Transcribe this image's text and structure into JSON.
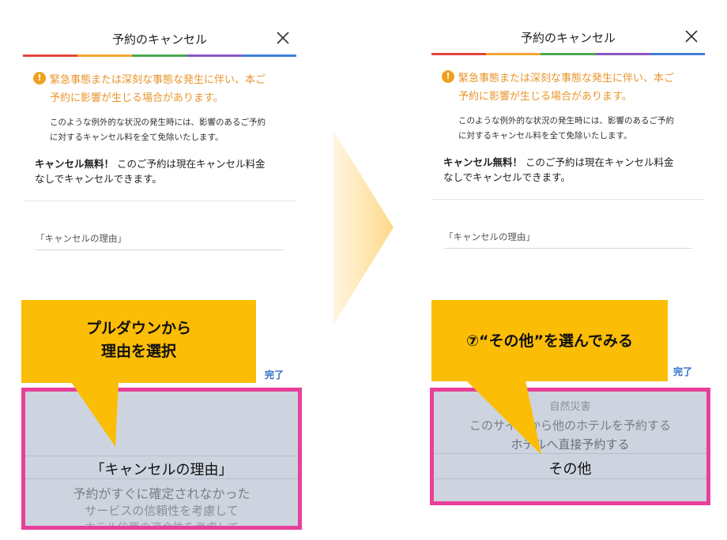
{
  "left": {
    "title": "予約のキャンセル",
    "alert_title_1": "緊急事態または深刻な事態な発生に伴い、本ご",
    "alert_title_2": "予約に影響が生じる場合があります。",
    "alert_body_1": "このような例外的な状況の発生時には、影響のあるご予約",
    "alert_body_2": "に対するキャンセル料を全て免除いたします。",
    "free_bold": "キャンセル無料！",
    "free_rest_1": " このご予約は現在キャンセル料金",
    "free_rest_2": "なしでキャンセルできます。",
    "reason_field": "「キャンセルの理由」",
    "done_label": "完了",
    "picker": {
      "selected": "「キャンセルの理由」",
      "option_1": "予約がすぐに確定されなかった",
      "option_2": "サービスの信頼性を考慮して",
      "option_3": "ホテル位置の適合性を考慮して"
    },
    "callout_line_1": "プルダウンから",
    "callout_line_2": "理由を選択"
  },
  "right": {
    "title": "予約のキャンセル",
    "alert_title_1": "緊急事態または深刻な事態な発生に伴い、本ご",
    "alert_title_2": "予約に影響が生じる場合があります。",
    "alert_body_1": "このような例外的な状況の発生時には、影響のあるご予約",
    "alert_body_2": "に対するキャンセル料を全て免除いたします。",
    "free_bold": "キャンセル無料！",
    "free_rest_1": " このご予約は現在キャンセル料金",
    "free_rest_2": "なしでキャンセルできます。",
    "reason_field": "「キャンセルの理由」",
    "done_label": "完了",
    "picker": {
      "option_top": "自然災害",
      "option_1": "このサイトから他のホテルを予約する",
      "option_2": "ホテルへ直接予約する",
      "selected": "その他"
    },
    "callout_text": "⑦“その他”を選んでみる"
  },
  "colors": {
    "alert_orange": "#e9952b",
    "callout_yellow": "#fbbd05",
    "picker_border": "#e8409a",
    "link_blue": "#2d6bc7",
    "rainbow": [
      "#e0463c",
      "#f3a531",
      "#4aa84f",
      "#8a56c4",
      "#3f7fd8"
    ]
  }
}
